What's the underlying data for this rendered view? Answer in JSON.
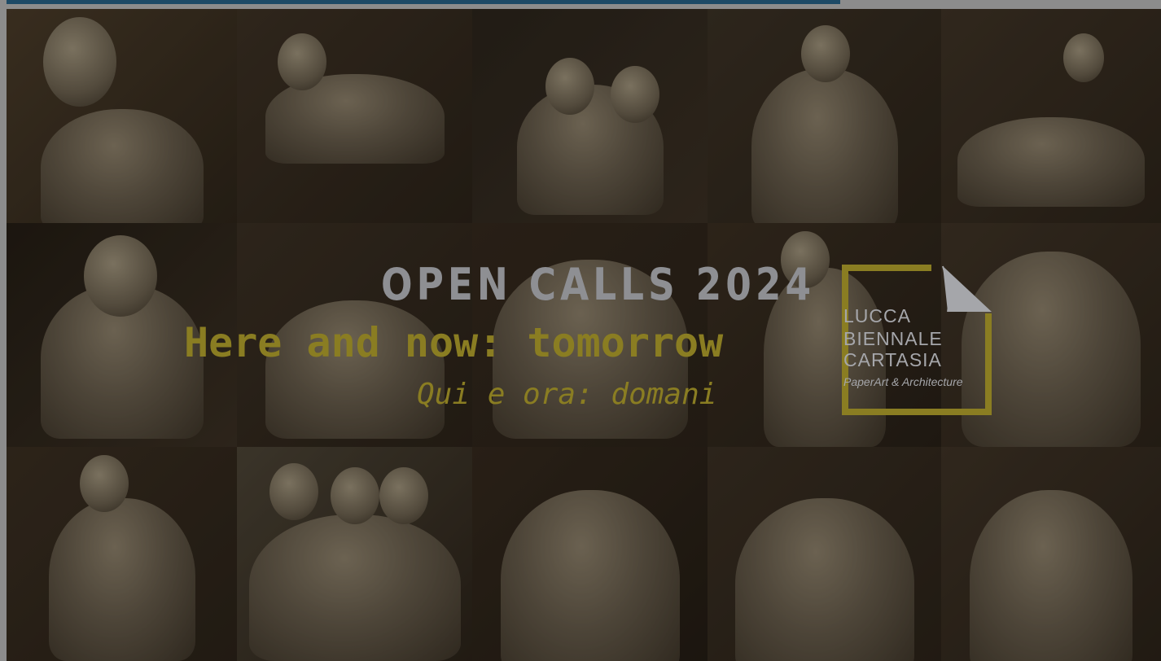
{
  "banner": {
    "heading": "OPEN CALLS 2024",
    "title_en": "Here and now: tomorrow",
    "title_it": "Qui e ora: domani"
  },
  "logo": {
    "line1": "LUCCA",
    "line2": "BIENNALE",
    "line3": "CARTASIA",
    "tagline": "PaperArt & Architecture"
  },
  "colors": {
    "accent": "#8a7d22",
    "heading": "#8e8f93",
    "topbar": "#1d4a66"
  }
}
